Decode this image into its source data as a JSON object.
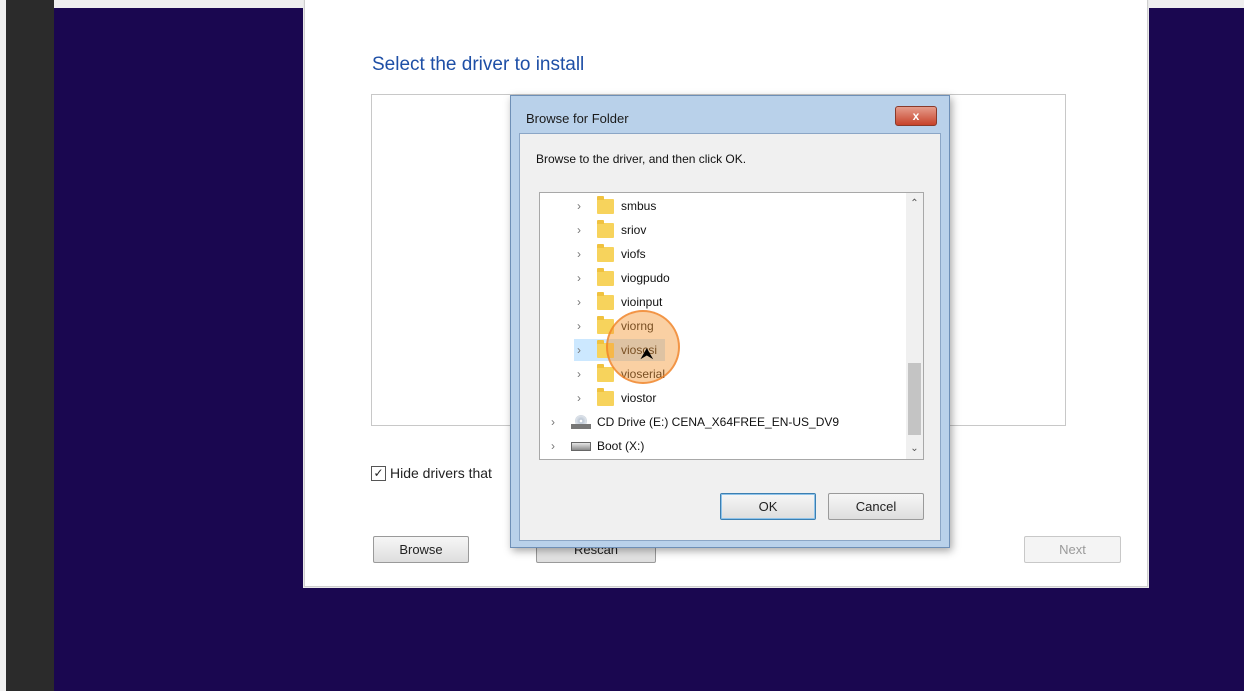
{
  "setup": {
    "title": "Select the driver to install",
    "hide_drivers_label": "Hide drivers that",
    "browse_label": "Browse",
    "rescan_label": "Rescan",
    "next_label": "Next"
  },
  "dialog": {
    "title": "Browse for Folder",
    "close_label": "x",
    "prompt": "Browse to the driver, and then click OK.",
    "tree_items": [
      {
        "label": "smbus",
        "type": "folder"
      },
      {
        "label": "sriov",
        "type": "folder"
      },
      {
        "label": "viofs",
        "type": "folder"
      },
      {
        "label": "viogpudo",
        "type": "folder"
      },
      {
        "label": "vioinput",
        "type": "folder"
      },
      {
        "label": "viorng",
        "type": "folder"
      },
      {
        "label": "vioscsi",
        "type": "folder",
        "selected": true
      },
      {
        "label": "vioserial",
        "type": "folder"
      },
      {
        "label": "viostor",
        "type": "folder"
      },
      {
        "label": "CD Drive (E:) CENA_X64FREE_EN-US_DV9",
        "type": "cd-drive"
      },
      {
        "label": "Boot (X:)",
        "type": "drive"
      }
    ],
    "ok_label": "OK",
    "cancel_label": "Cancel"
  }
}
